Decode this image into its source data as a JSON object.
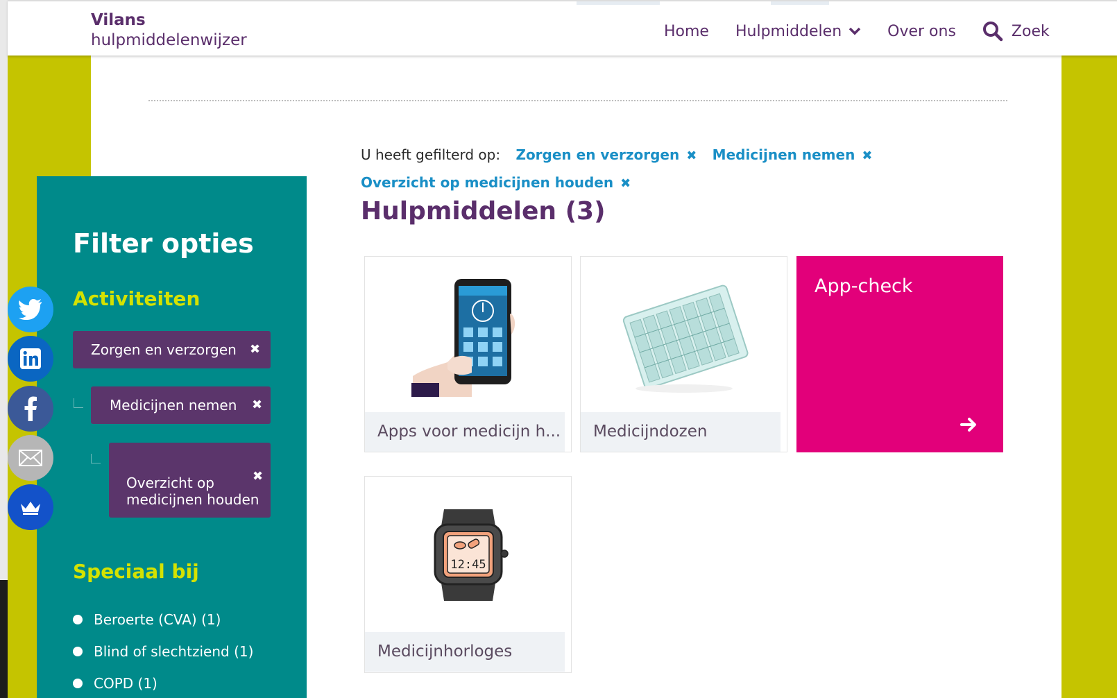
{
  "header": {
    "brand": "Vilans",
    "subtitle": "hulpmiddelenwijzer",
    "nav": {
      "home": "Home",
      "hulpmiddelen": "Hulpmiddelen",
      "over_ons": "Over ons",
      "search": "Zoek"
    }
  },
  "filters": {
    "prefix": "U heeft gefilterd op:",
    "active": [
      "Zorgen en verzorgen",
      "Medicijnen nemen",
      "Overzicht op medicijnen houden"
    ],
    "remove_symbol": "✖"
  },
  "results": {
    "title": "Hulpmiddelen (3)",
    "cards": [
      {
        "caption": "Apps voor medicijn h...",
        "icon": "phone-health-monitoring-image"
      },
      {
        "caption": "Medicijndozen",
        "icon": "pill-organizer-image"
      },
      {
        "caption": "Medicijnhorloges",
        "icon": "medicine-watch-image"
      }
    ],
    "promo": {
      "title": "App-check",
      "icon": "arrow-right-icon"
    }
  },
  "sidebar": {
    "title": "Filter opties",
    "activities_heading": "Activiteiten",
    "activities": [
      "Zorgen en verzorgen",
      "Medicijnen nemen",
      "Overzicht op medicijnen houden"
    ],
    "special_heading": "Speciaal bij",
    "special": [
      "Beroerte (CVA) (1)",
      "Blind of slechtziend (1)",
      "COPD (1)"
    ]
  },
  "share": [
    "twitter-icon",
    "linkedin-icon",
    "facebook-icon",
    "email-icon",
    "crown-icon"
  ],
  "colors": {
    "brand_purple": "#5a2e6b",
    "teal": "#008a8a",
    "lime": "#c5c400",
    "magenta": "#e2007a",
    "link_blue": "#1a8fc6",
    "chip_purple": "#5b356b",
    "heading_lime": "#d4e200"
  }
}
